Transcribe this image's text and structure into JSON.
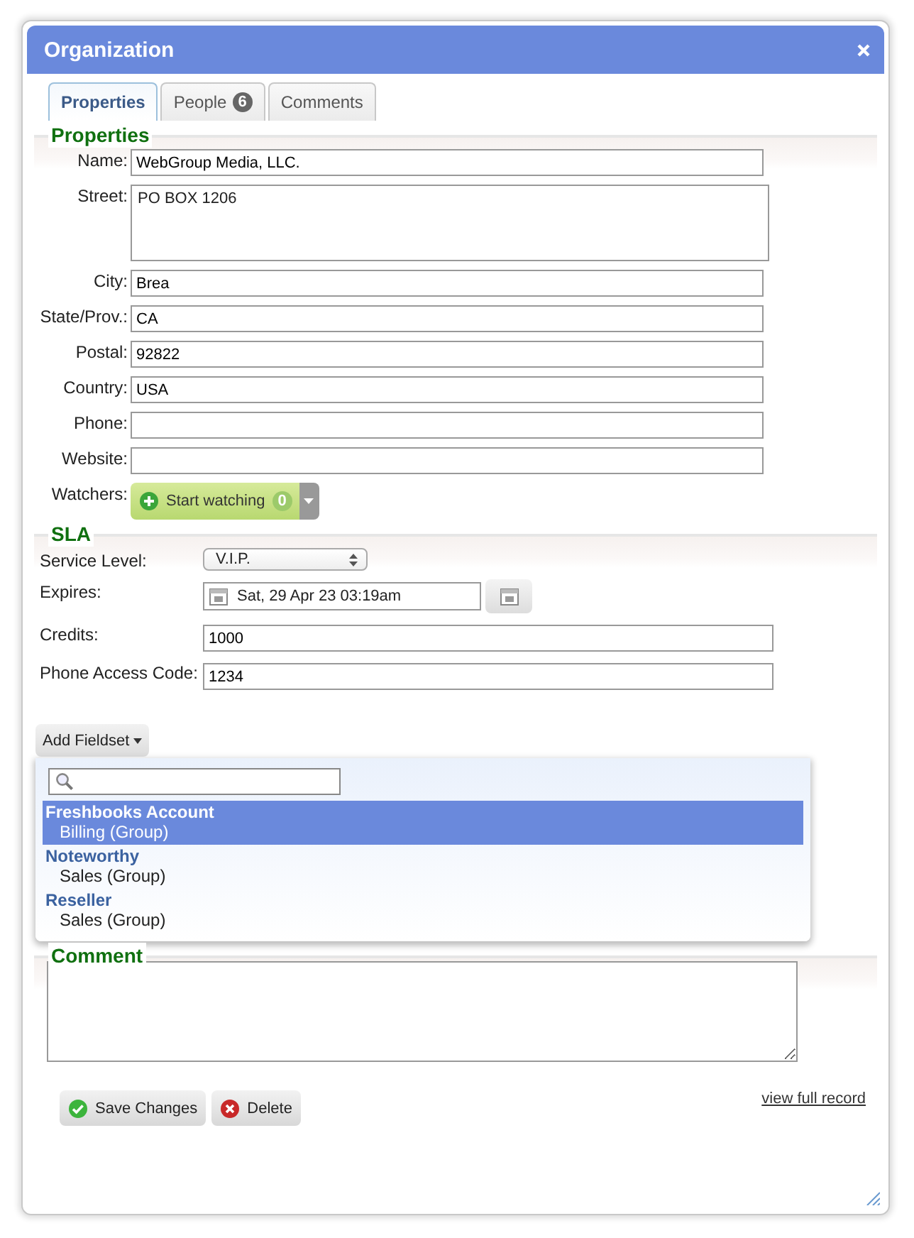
{
  "window": {
    "title": "Organization"
  },
  "tabs": [
    {
      "label": "Properties",
      "selected": true
    },
    {
      "label": "People",
      "badge": "6",
      "selected": false
    },
    {
      "label": "Comments",
      "selected": false
    }
  ],
  "properties": {
    "legend": "Properties",
    "fields": [
      {
        "label": "Name:",
        "value": "WebGroup Media, LLC.",
        "kind": "text"
      },
      {
        "label": "Street:",
        "value": "PO BOX 1206",
        "kind": "textarea"
      },
      {
        "label": "City:",
        "value": "Brea",
        "kind": "text"
      },
      {
        "label": "State/Prov.:",
        "value": "CA",
        "kind": "text"
      },
      {
        "label": "Postal:",
        "value": "92822",
        "kind": "text"
      },
      {
        "label": "Country:",
        "value": "USA",
        "kind": "text"
      },
      {
        "label": "Phone:",
        "kind": "text"
      },
      {
        "label": "Website:",
        "kind": "text"
      }
    ],
    "watchers": {
      "label": "Watchers:",
      "button": "Start watching",
      "count": "0"
    }
  },
  "sla": {
    "legend": "SLA",
    "fields": [
      {
        "label": "Service Level:",
        "value": "V.I.P.",
        "kind": "select"
      },
      {
        "label": "Expires:",
        "value": "Sat, 29 Apr 23 03:19am",
        "kind": "date"
      },
      {
        "label": "Credits:",
        "value": "1000",
        "kind": "text"
      },
      {
        "label": "Phone Access Code:",
        "value": "1234",
        "kind": "text"
      }
    ]
  },
  "add_fieldset": {
    "button": "Add Fieldset",
    "groups": [
      {
        "title": "Freshbooks Account",
        "subtitle": "Billing (Group)",
        "selected": true
      },
      {
        "title": "Noteworthy",
        "subtitle": "Sales (Group)",
        "selected": false
      },
      {
        "title": "Reseller",
        "subtitle": "Sales (Group)",
        "selected": false
      }
    ]
  },
  "comment": {
    "legend": "Comment"
  },
  "footer": {
    "buttons": [
      {
        "label": "Save Changes",
        "kind": "save"
      },
      {
        "label": "Delete",
        "kind": "delete"
      }
    ],
    "link": "view full record"
  }
}
